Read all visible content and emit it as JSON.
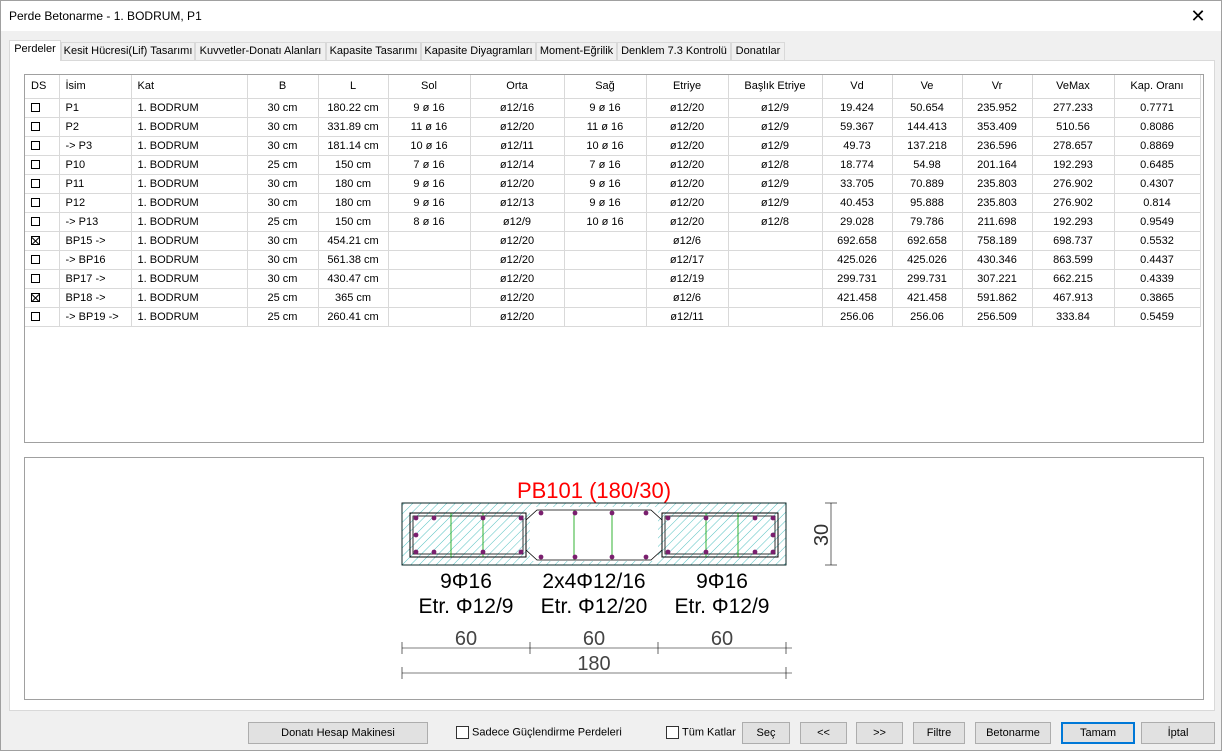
{
  "window": {
    "title": "Perde Betonarme - 1. BODRUM, P1",
    "close_glyph": "✕"
  },
  "tabs": [
    {
      "label": "Perdeler",
      "active": true
    },
    {
      "label": "Kesit Hücresi(Lif) Tasarımı"
    },
    {
      "label": "Kuvvetler-Donatı Alanları"
    },
    {
      "label": "Kapasite Tasarımı"
    },
    {
      "label": "Kapasite Diyagramları"
    },
    {
      "label": "Moment-Eğrilik"
    },
    {
      "label": "Denklem 7.3 Kontrolü"
    },
    {
      "label": "Donatılar"
    }
  ],
  "table": {
    "columns": [
      "DS",
      "İsim",
      "Kat",
      "B",
      "L",
      "Sol",
      "Orta",
      "Sağ",
      "Etriye",
      "Başlık Etriye",
      "Vd",
      "Ve",
      "Vr",
      "VeMax",
      "Kap. Oranı"
    ],
    "rows": [
      {
        "ds": false,
        "cells": [
          "P1",
          "1. BODRUM",
          "30 cm",
          "180.22 cm",
          "9 ø 16",
          "ø12/16",
          "9 ø 16",
          "ø12/20",
          "ø12/9",
          "19.424",
          "50.654",
          "235.952",
          "277.233",
          "0.7771"
        ]
      },
      {
        "ds": false,
        "cells": [
          "P2",
          "1. BODRUM",
          "30 cm",
          "331.89 cm",
          "11 ø 16",
          "ø12/20",
          "11 ø 16",
          "ø12/20",
          "ø12/9",
          "59.367",
          "144.413",
          "353.409",
          "510.56",
          "0.8086"
        ]
      },
      {
        "ds": false,
        "cells": [
          "-> P3",
          "1. BODRUM",
          "30 cm",
          "181.14 cm",
          "10 ø 16",
          "ø12/11",
          "10 ø 16",
          "ø12/20",
          "ø12/9",
          "49.73",
          "137.218",
          "236.596",
          "278.657",
          "0.8869"
        ]
      },
      {
        "ds": false,
        "cells": [
          "P10",
          "1. BODRUM",
          "25 cm",
          "150 cm",
          "7 ø 16",
          "ø12/14",
          "7 ø 16",
          "ø12/20",
          "ø12/8",
          "18.774",
          "54.98",
          "201.164",
          "192.293",
          "0.6485"
        ]
      },
      {
        "ds": false,
        "cells": [
          "P11",
          "1. BODRUM",
          "30 cm",
          "180 cm",
          "9 ø 16",
          "ø12/20",
          "9 ø 16",
          "ø12/20",
          "ø12/9",
          "33.705",
          "70.889",
          "235.803",
          "276.902",
          "0.4307"
        ]
      },
      {
        "ds": false,
        "cells": [
          "P12",
          "1. BODRUM",
          "30 cm",
          "180 cm",
          "9 ø 16",
          "ø12/13",
          "9 ø 16",
          "ø12/20",
          "ø12/9",
          "40.453",
          "95.888",
          "235.803",
          "276.902",
          "0.814"
        ]
      },
      {
        "ds": false,
        "cells": [
          "-> P13",
          "1. BODRUM",
          "25 cm",
          "150 cm",
          "8 ø 16",
          "ø12/9",
          "10 ø 16",
          "ø12/20",
          "ø12/8",
          "29.028",
          "79.786",
          "211.698",
          "192.293",
          "0.9549"
        ]
      },
      {
        "ds": true,
        "cells": [
          "BP15 ->",
          "1. BODRUM",
          "30 cm",
          "454.21 cm",
          "",
          "ø12/20",
          "",
          "ø12/6",
          "",
          "692.658",
          "692.658",
          "758.189",
          "698.737",
          "0.5532"
        ]
      },
      {
        "ds": false,
        "cells": [
          "-> BP16",
          "1. BODRUM",
          "30 cm",
          "561.38 cm",
          "",
          "ø12/20",
          "",
          "ø12/17",
          "",
          "425.026",
          "425.026",
          "430.346",
          "863.599",
          "0.4437"
        ]
      },
      {
        "ds": false,
        "cells": [
          "BP17 ->",
          "1. BODRUM",
          "30 cm",
          "430.47 cm",
          "",
          "ø12/20",
          "",
          "ø12/19",
          "",
          "299.731",
          "299.731",
          "307.221",
          "662.215",
          "0.4339"
        ]
      },
      {
        "ds": true,
        "cells": [
          "BP18 ->",
          "1. BODRUM",
          "25 cm",
          "365 cm",
          "",
          "ø12/20",
          "",
          "ø12/6",
          "",
          "421.458",
          "421.458",
          "591.862",
          "467.913",
          "0.3865"
        ]
      },
      {
        "ds": false,
        "cells": [
          "-> BP19 ->",
          "1. BODRUM",
          "25 cm",
          "260.41 cm",
          "",
          "ø12/20",
          "",
          "ø12/11",
          "",
          "256.06",
          "256.06",
          "256.509",
          "333.84",
          "0.5459"
        ]
      }
    ]
  },
  "drawing": {
    "title": "PB101 (180/30)",
    "title_color": "#ff0000",
    "depth_label": "30",
    "zones": [
      {
        "bars": "9Φ16",
        "stirrup": "Etr. Φ12/9",
        "width": "60"
      },
      {
        "bars": "2x4Φ12/16",
        "stirrup": "Etr. Φ12/20",
        "width": "60"
      },
      {
        "bars": "9Φ16",
        "stirrup": "Etr. Φ12/9",
        "width": "60"
      }
    ],
    "total_width": "180"
  },
  "bottom": {
    "calc_button": "Donatı Hesap Makinesi",
    "only_strengthening": "Sadece Güçlendirme Perdeleri",
    "all_floors": "Tüm Katlar",
    "select": "Seç",
    "prev": "<<",
    "next": ">>",
    "filter": "Filtre",
    "concrete": "Betonarme",
    "ok": "Tamam",
    "cancel": "İptal"
  }
}
